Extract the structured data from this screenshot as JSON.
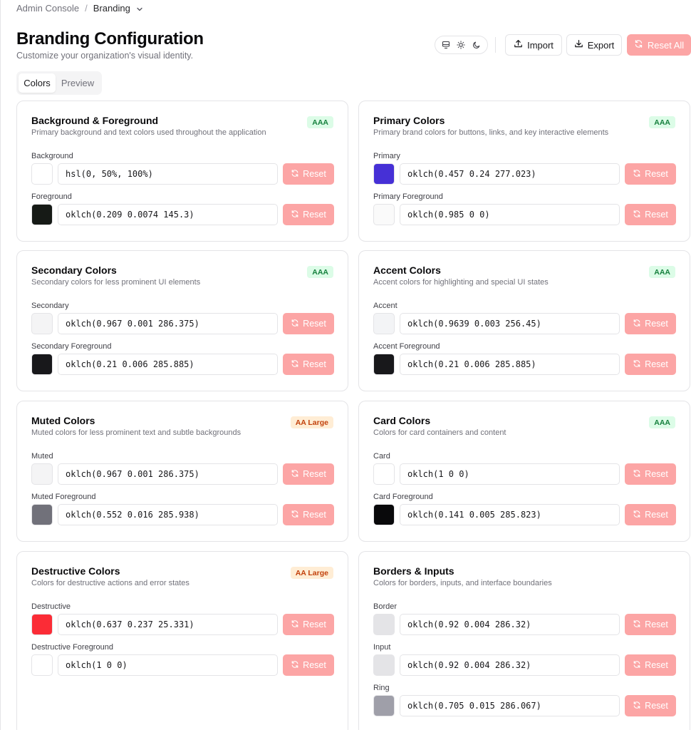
{
  "breadcrumb": {
    "root": "Admin Console",
    "separator": "/",
    "current": "Branding"
  },
  "header": {
    "title": "Branding Configuration",
    "subtitle": "Customize your organization's visual identity.",
    "import_label": "Import",
    "export_label": "Export",
    "reset_all_label": "Reset All"
  },
  "tabs": [
    {
      "label": "Colors",
      "active": true
    },
    {
      "label": "Preview",
      "active": false
    }
  ],
  "reset_label": "Reset",
  "colors": {
    "accent_reset": "#fca5a5",
    "badge_aaa_bg": "#dcfce7",
    "badge_aa_large_bg": "#ffedd5"
  },
  "cards": [
    {
      "title": "Background & Foreground",
      "description": "Primary background and text colors used throughout the application",
      "badge": "AAA",
      "fields": [
        {
          "label": "Background",
          "value": "hsl(0, 50%, 100%)",
          "swatch": "#ffffff"
        },
        {
          "label": "Foreground",
          "value": "oklch(0.209 0.0074 145.3)",
          "swatch": "#161a16"
        }
      ]
    },
    {
      "title": "Primary Colors",
      "description": "Primary brand colors for buttons, links, and key interactive elements",
      "badge": "AAA",
      "fields": [
        {
          "label": "Primary",
          "value": "oklch(0.457 0.24 277.023)",
          "swatch": "#4630d6"
        },
        {
          "label": "Primary Foreground",
          "value": "oklch(0.985 0 0)",
          "swatch": "#fafafa"
        }
      ]
    },
    {
      "title": "Secondary Colors",
      "description": "Secondary colors for less prominent UI elements",
      "badge": "AAA",
      "fields": [
        {
          "label": "Secondary",
          "value": "oklch(0.967 0.001 286.375)",
          "swatch": "#f4f4f5"
        },
        {
          "label": "Secondary Foreground",
          "value": "oklch(0.21 0.006 285.885)",
          "swatch": "#18181b"
        }
      ]
    },
    {
      "title": "Accent Colors",
      "description": "Accent colors for highlighting and special UI states",
      "badge": "AAA",
      "fields": [
        {
          "label": "Accent",
          "value": "oklch(0.9639 0.003 256.45)",
          "swatch": "#f3f4f6"
        },
        {
          "label": "Accent Foreground",
          "value": "oklch(0.21 0.006 285.885)",
          "swatch": "#18181b"
        }
      ]
    },
    {
      "title": "Muted Colors",
      "description": "Muted colors for less prominent text and subtle backgrounds",
      "badge": "AA Large",
      "fields": [
        {
          "label": "Muted",
          "value": "oklch(0.967 0.001 286.375)",
          "swatch": "#f4f4f5"
        },
        {
          "label": "Muted Foreground",
          "value": "oklch(0.552 0.016 285.938)",
          "swatch": "#71717a"
        }
      ]
    },
    {
      "title": "Card Colors",
      "description": "Colors for card containers and content",
      "badge": "AAA",
      "fields": [
        {
          "label": "Card",
          "value": "oklch(1 0 0)",
          "swatch": "#ffffff"
        },
        {
          "label": "Card Foreground",
          "value": "oklch(0.141 0.005 285.823)",
          "swatch": "#09090b"
        }
      ]
    },
    {
      "title": "Destructive Colors",
      "description": "Colors for destructive actions and error states",
      "badge": "AA Large",
      "fields": [
        {
          "label": "Destructive",
          "value": "oklch(0.637 0.237 25.331)",
          "swatch": "#fb2c36"
        },
        {
          "label": "Destructive Foreground",
          "value": "oklch(1 0 0)",
          "swatch": "#ffffff"
        }
      ]
    },
    {
      "title": "Borders & Inputs",
      "description": "Colors for borders, inputs, and interface boundaries",
      "badge": "",
      "fields": [
        {
          "label": "Border",
          "value": "oklch(0.92 0.004 286.32)",
          "swatch": "#e4e4e7"
        },
        {
          "label": "Input",
          "value": "oklch(0.92 0.004 286.32)",
          "swatch": "#e4e4e7"
        },
        {
          "label": "Ring",
          "value": "oklch(0.705 0.015 286.067)",
          "swatch": "#9f9fa9"
        }
      ]
    }
  ]
}
